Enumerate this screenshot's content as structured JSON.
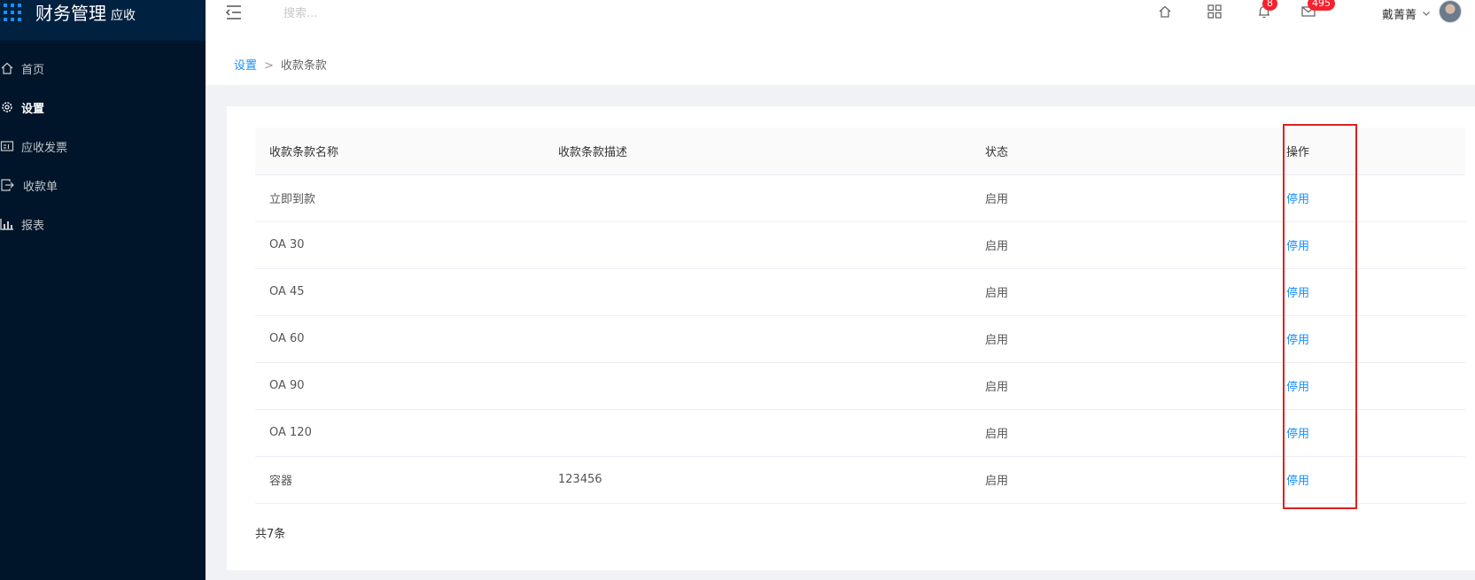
{
  "app": {
    "title": "财务管理",
    "subtitle": "应收"
  },
  "sidebar": {
    "items": [
      {
        "label": "首页",
        "icon": "home-icon"
      },
      {
        "label": "设置",
        "icon": "gear-icon"
      },
      {
        "label": "应收发票",
        "icon": "invoice-icon"
      },
      {
        "label": "收款单",
        "icon": "receipt-icon"
      },
      {
        "label": "报表",
        "icon": "bar-chart-icon"
      }
    ],
    "active_index": 1
  },
  "header": {
    "search_placeholder": "搜索...",
    "notification_count": "8",
    "message_count": "495",
    "user_name": "戴菁菁"
  },
  "breadcrumb": {
    "parent": "设置",
    "separator": ">",
    "current": "收款条款"
  },
  "table": {
    "columns": [
      "收款条款名称",
      "收款条款描述",
      "状态",
      "操作"
    ],
    "rows": [
      {
        "name": "立即到款",
        "description": "",
        "status": "启用",
        "action": "停用"
      },
      {
        "name": "OA 30",
        "description": "",
        "status": "启用",
        "action": "停用"
      },
      {
        "name": "OA 45",
        "description": "",
        "status": "启用",
        "action": "停用"
      },
      {
        "name": "OA 60",
        "description": "",
        "status": "启用",
        "action": "停用"
      },
      {
        "name": "OA 90",
        "description": "",
        "status": "启用",
        "action": "停用"
      },
      {
        "name": "OA 120",
        "description": "",
        "status": "启用",
        "action": "停用"
      },
      {
        "name": "容器",
        "description": "123456",
        "status": "启用",
        "action": "停用"
      }
    ],
    "total_text": "共7条"
  },
  "colors": {
    "sidebar_bg": "#001529",
    "logo_bg": "#002140",
    "accent": "#1890ff",
    "badge": "#f5222d",
    "highlight": "#e02020"
  }
}
